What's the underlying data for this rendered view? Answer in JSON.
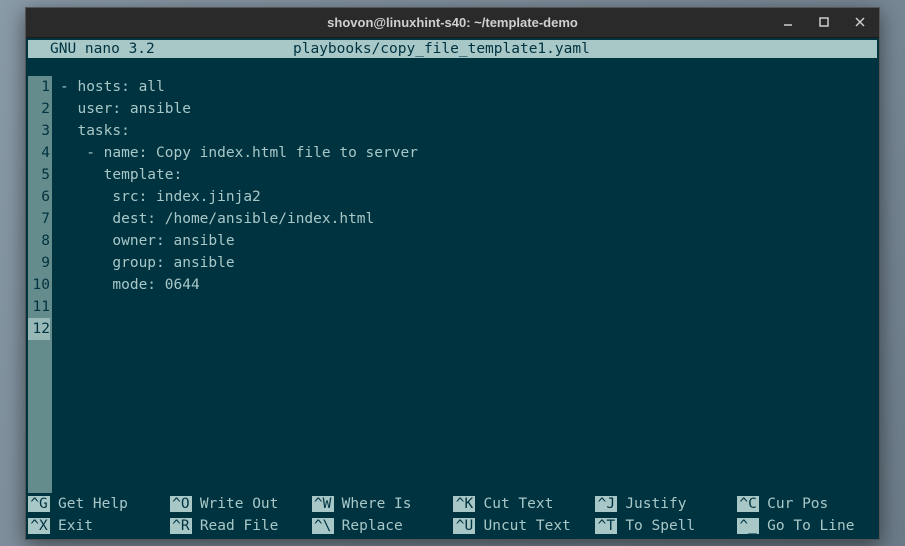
{
  "window": {
    "title": "shovon@linuxhint-s40: ~/template-demo"
  },
  "nano": {
    "version": "GNU nano 3.2",
    "filename": "playbooks/copy_file_template1.yaml"
  },
  "lines": [
    {
      "num": "1",
      "text": "- hosts: all"
    },
    {
      "num": "2",
      "text": "  user: ansible"
    },
    {
      "num": "3",
      "text": "  tasks:"
    },
    {
      "num": "4",
      "text": "   - name: Copy index.html file to server"
    },
    {
      "num": "5",
      "text": "     template:"
    },
    {
      "num": "6",
      "text": "      src: index.jinja2"
    },
    {
      "num": "7",
      "text": "      dest: /home/ansible/index.html"
    },
    {
      "num": "8",
      "text": "      owner: ansible"
    },
    {
      "num": "9",
      "text": "      group: ansible"
    },
    {
      "num": "10",
      "text": "      mode: 0644"
    },
    {
      "num": "11",
      "text": ""
    },
    {
      "num": "12",
      "text": ""
    }
  ],
  "currentLine": 12,
  "shortcuts": {
    "row1": [
      {
        "key": "^G",
        "label": "Get Help"
      },
      {
        "key": "^O",
        "label": "Write Out"
      },
      {
        "key": "^W",
        "label": "Where Is"
      },
      {
        "key": "^K",
        "label": "Cut Text"
      },
      {
        "key": "^J",
        "label": "Justify"
      },
      {
        "key": "^C",
        "label": "Cur Pos"
      }
    ],
    "row2": [
      {
        "key": "^X",
        "label": "Exit"
      },
      {
        "key": "^R",
        "label": "Read File"
      },
      {
        "key": "^\\",
        "label": "Replace"
      },
      {
        "key": "^U",
        "label": "Uncut Text"
      },
      {
        "key": "^T",
        "label": "To Spell"
      },
      {
        "key": "^_",
        "label": "Go To Line"
      }
    ]
  }
}
